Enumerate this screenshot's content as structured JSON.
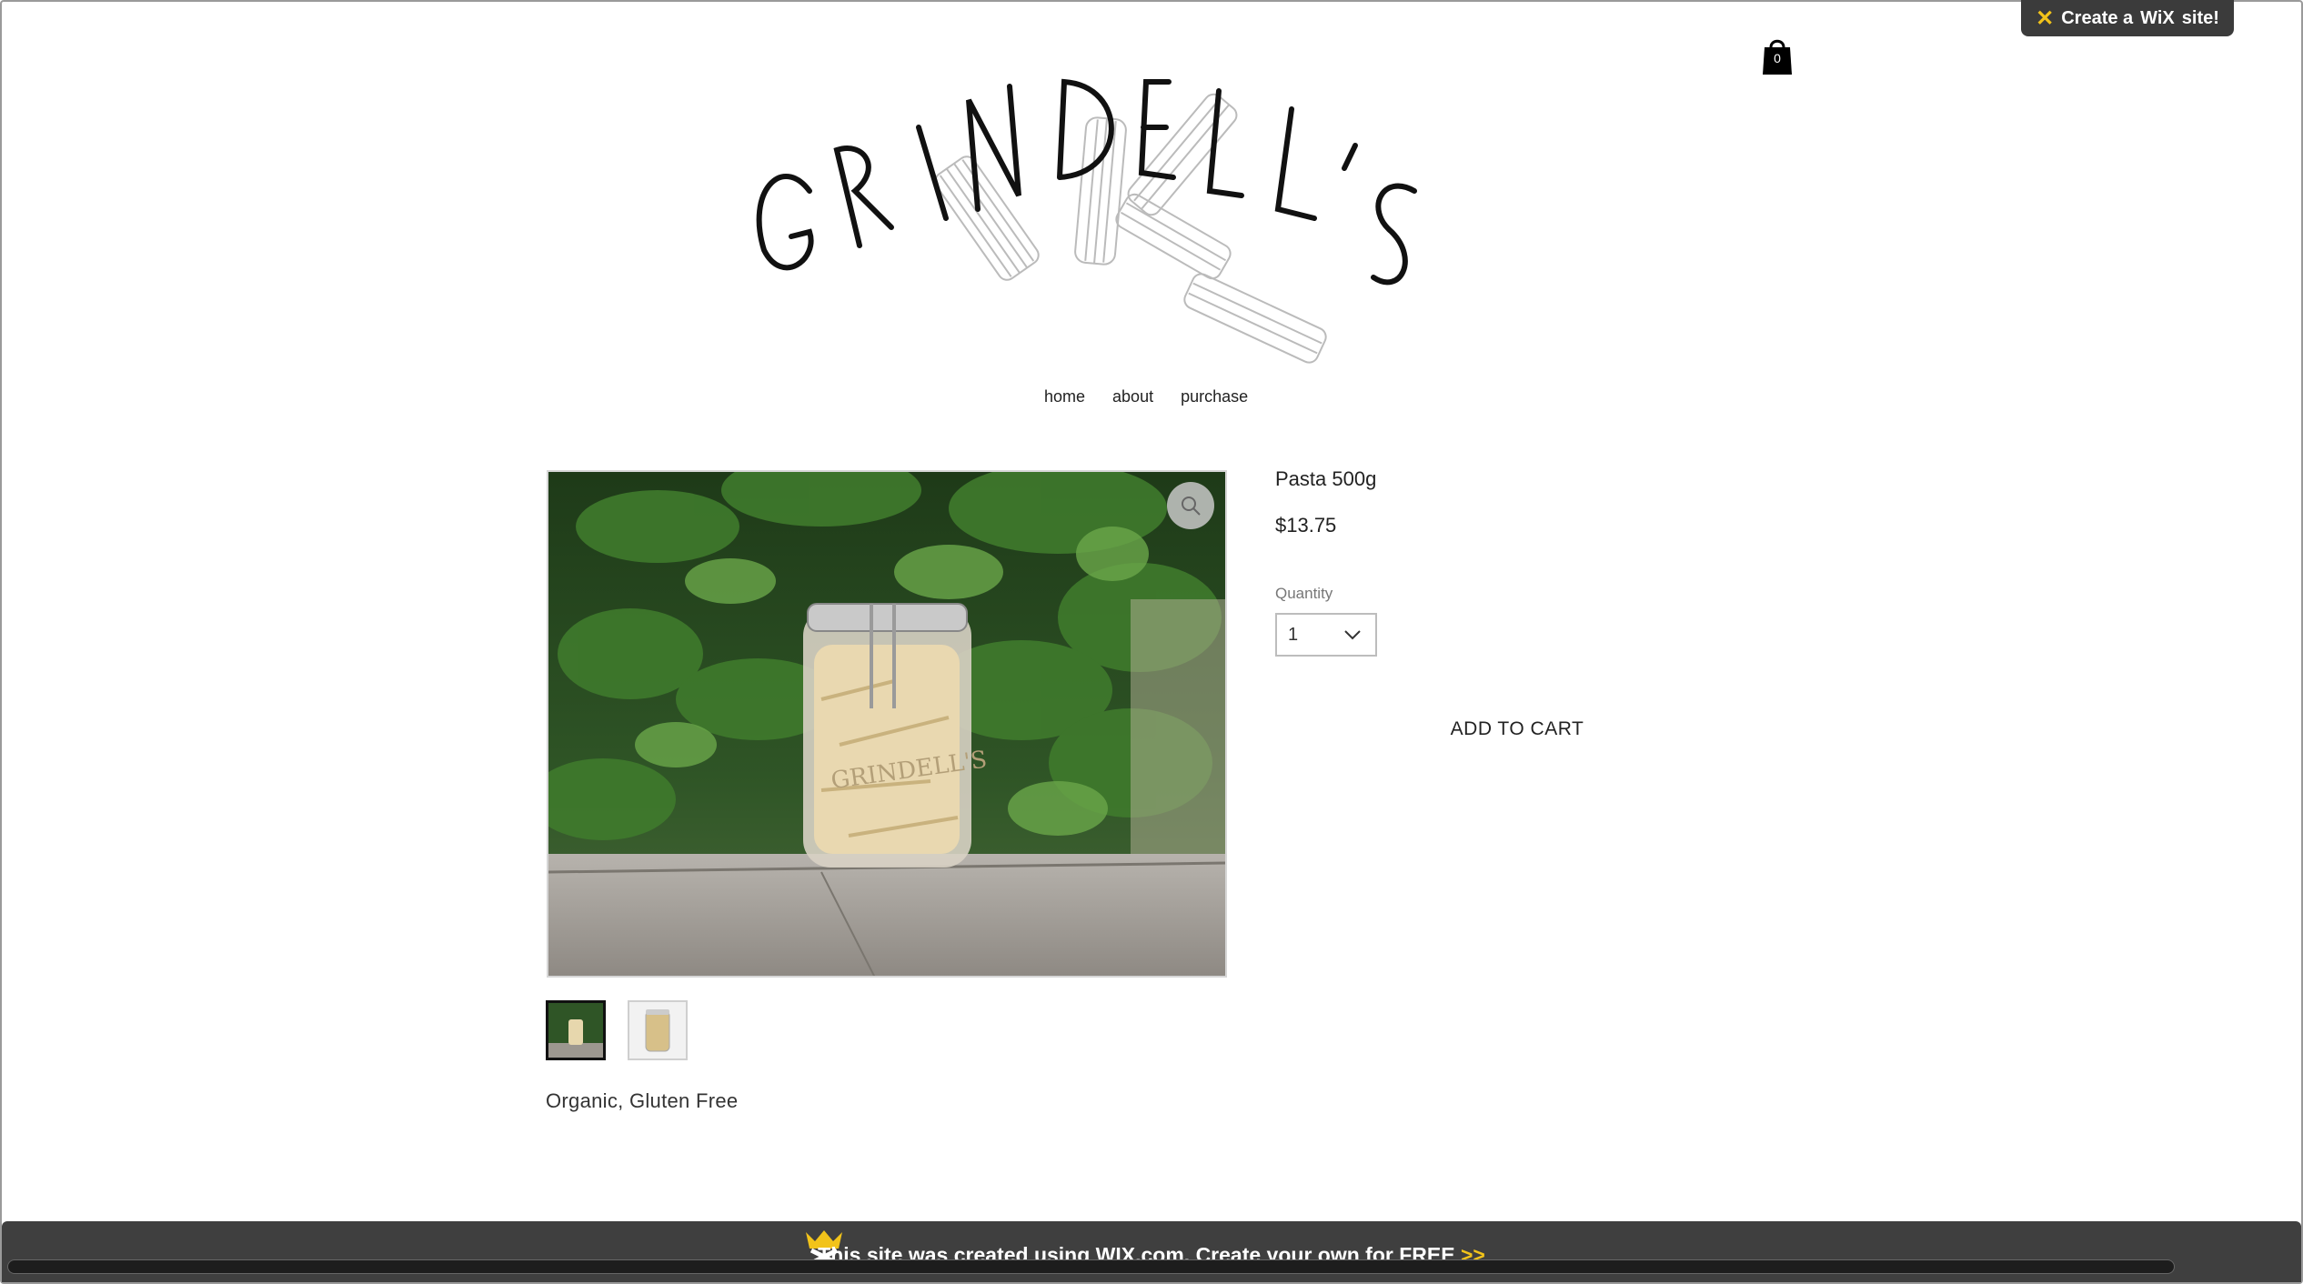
{
  "wix_badge": {
    "prefix": "Create a",
    "brand": "WiX",
    "suffix": "site!"
  },
  "cart": {
    "count": "0"
  },
  "logo": {
    "text": "GRINDELL'S"
  },
  "nav": {
    "items": [
      "home",
      "about",
      "purchase"
    ]
  },
  "product": {
    "title": "Pasta 500g",
    "price": "$13.75",
    "quantity_label": "Quantity",
    "quantity_value": "1",
    "add_to_cart": "ADD TO CART",
    "description": "Organic, Gluten Free",
    "jar_label": "GRINDELL'S"
  },
  "footer_banner": {
    "text": "This site was created using WIX.com. Create your own for FREE",
    "arrows": ">>"
  },
  "colors": {
    "banner_bg": "#3f3f3f",
    "wix_yellow": "#f2c31a",
    "text": "#222222"
  }
}
